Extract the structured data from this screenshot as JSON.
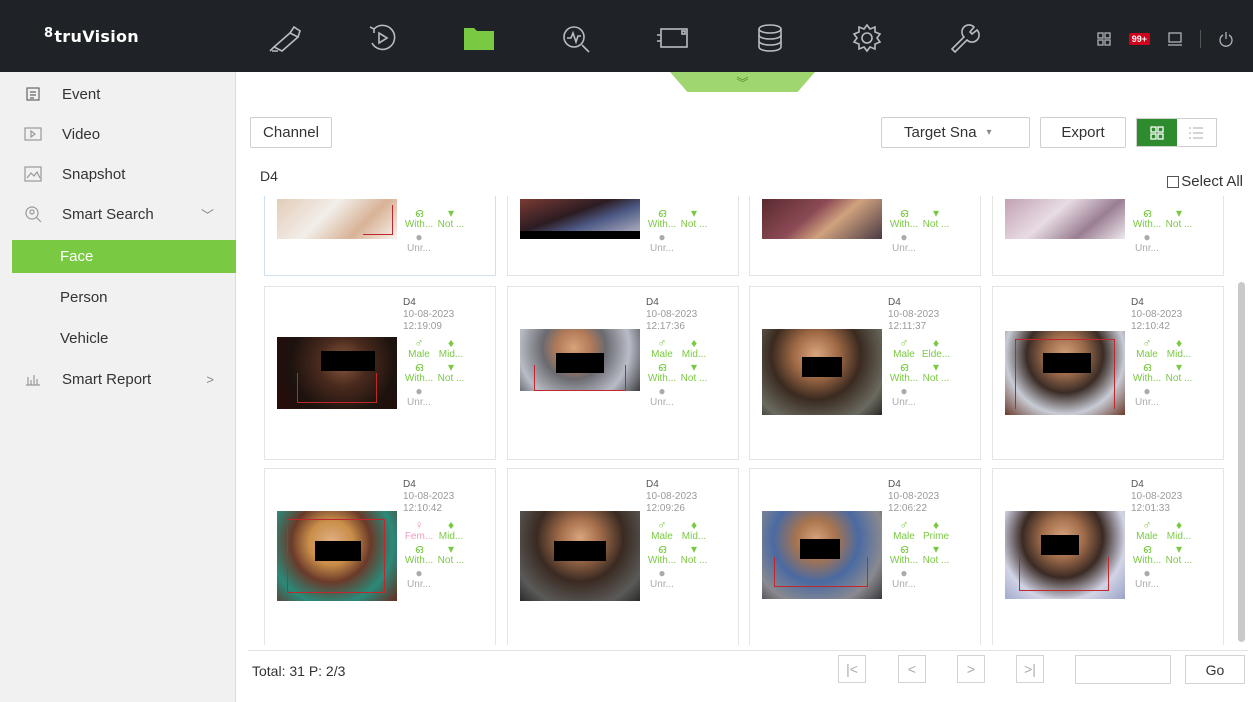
{
  "app": {
    "logo_prefix": "8",
    "logo_text": "truVision"
  },
  "topnav": [
    {
      "name": "live-view-icon"
    },
    {
      "name": "playback-icon"
    },
    {
      "name": "file-search-icon"
    },
    {
      "name": "smart-analysis-icon"
    },
    {
      "name": "camera-setup-icon"
    },
    {
      "name": "storage-icon"
    },
    {
      "name": "configuration-icon"
    },
    {
      "name": "maintenance-icon"
    }
  ],
  "topright": {
    "alarm_badge": "99+"
  },
  "sidebar": {
    "items": [
      {
        "label": "Event",
        "icon": "event-icon"
      },
      {
        "label": "Video",
        "icon": "video-icon"
      },
      {
        "label": "Snapshot",
        "icon": "snapshot-icon"
      },
      {
        "label": "Smart Search",
        "icon": "smart-search-icon"
      }
    ],
    "sub": [
      "Face",
      "Person",
      "Vehicle"
    ],
    "report": {
      "label": "Smart Report",
      "icon": "smart-report-icon"
    }
  },
  "toolbar": {
    "channel_button": "Channel",
    "target_select": "Target Sna",
    "export_button": "Export",
    "view": "grid"
  },
  "channel_label": "D4",
  "select_all": "Select All",
  "results_top_row": [
    {
      "glasses": "With...",
      "mask": "Not ...",
      "other": "Unr..."
    },
    {
      "glasses": "With...",
      "mask": "Not ...",
      "other": "Unr..."
    },
    {
      "glasses": "With...",
      "mask": "Not ...",
      "other": "Unr..."
    },
    {
      "glasses": "With...",
      "mask": "Not ...",
      "other": "Unr..."
    }
  ],
  "results": [
    {
      "channel": "D4",
      "date": "10-08-2023",
      "time": "12:19:09",
      "gender": "Male",
      "age": "Mid...",
      "glasses": "With...",
      "mask": "Not ...",
      "other": "Unr..."
    },
    {
      "channel": "D4",
      "date": "10-08-2023",
      "time": "12:17:36",
      "gender": "Male",
      "age": "Mid...",
      "glasses": "With...",
      "mask": "Not ...",
      "other": "Unr..."
    },
    {
      "channel": "D4",
      "date": "10-08-2023",
      "time": "12:11:37",
      "gender": "Male",
      "age": "Elde...",
      "glasses": "With...",
      "mask": "Not ...",
      "other": "Unr..."
    },
    {
      "channel": "D4",
      "date": "10-08-2023",
      "time": "12:10:42",
      "gender": "Male",
      "age": "Mid...",
      "glasses": "With...",
      "mask": "Not ...",
      "other": "Unr..."
    },
    {
      "channel": "D4",
      "date": "10-08-2023",
      "time": "12:10:42",
      "gender": "Fem...",
      "age": "Mid...",
      "glasses": "With...",
      "mask": "Not ...",
      "other": "Unr..."
    },
    {
      "channel": "D4",
      "date": "10-08-2023",
      "time": "12:09:26",
      "gender": "Male",
      "age": "Mid...",
      "glasses": "With...",
      "mask": "Not ...",
      "other": "Unr..."
    },
    {
      "channel": "D4",
      "date": "10-08-2023",
      "time": "12:06:22",
      "gender": "Male",
      "age": "Prime",
      "glasses": "With...",
      "mask": "Not ...",
      "other": "Unr..."
    },
    {
      "channel": "D4",
      "date": "10-08-2023",
      "time": "12:01:33",
      "gender": "Male",
      "age": "Mid...",
      "glasses": "With...",
      "mask": "Not ...",
      "other": "Unr..."
    }
  ],
  "footer": {
    "total": "Total: 31  P: 2/3",
    "first": "|<",
    "prev": "<",
    "next": ">",
    "last": ">|",
    "go": "Go"
  },
  "colors": {
    "accent": "#7ac943",
    "header": "#1f2226",
    "mask_bar": "#000000",
    "bracket": "#c0282d"
  }
}
